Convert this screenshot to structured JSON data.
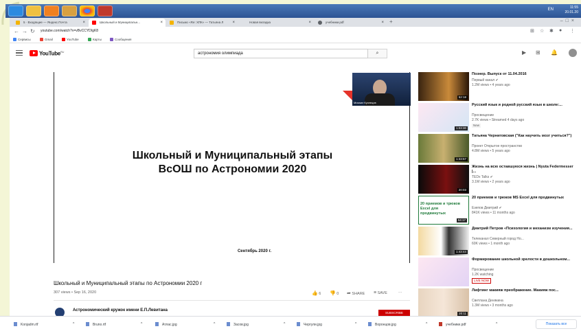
{
  "colors": {
    "youtube_red": "#ff0000",
    "subscribe_red": "#cc0000",
    "taskbar_blue": "#3a68a8",
    "link_blue": "#1a73e8"
  },
  "os_taskbar": {
    "apps": [
      "ie-icon",
      "explorer-icon",
      "media-player-icon",
      "folder-icon",
      "chrome-icon",
      "pdf-icon"
    ],
    "tray_lang": "EN",
    "clock_time": "11:55",
    "clock_date": "20.01.20"
  },
  "browser": {
    "tabs": [
      {
        "label": "5 · Входящие — Яндекс.Почта",
        "color": "#f4b400"
      },
      {
        "label": "Школьный и Муниципальн...",
        "color": "#ff0000",
        "active": true
      },
      {
        "label": "Письмо «Re: ХПК» — Татьяна Л",
        "color": "#f4b400"
      },
      {
        "label": "Новая вкладка",
        "color": "#ffffff"
      },
      {
        "label": "учебники.pdf",
        "color": "#5f6368"
      }
    ],
    "url": "youtube.com/watch?v=vBvCCYDIgK8",
    "bookmarks": [
      {
        "label": "Сервисы",
        "color": "#4285f4"
      },
      {
        "label": "Gmail",
        "color": "#ea4335"
      },
      {
        "label": "YouTube",
        "color": "#ff0000"
      },
      {
        "label": "Карты",
        "color": "#34a853"
      },
      {
        "label": "Сообщения",
        "color": "#7e57c2"
      }
    ]
  },
  "youtube": {
    "logo_text": "YouTube",
    "logo_region": "RU",
    "search_value": "астрономия олимпиада",
    "slide": {
      "title_line1": "Школьный и Муниципальный этапы",
      "title_line2": "ВсОШ по Астрономии 2020",
      "date": "Сентябрь 2020 г.",
      "webcam_label": "Михаил Кузнецов"
    },
    "video_title": "Школьный и Муниципальный этапы по Астрономии 2020 г",
    "video_meta": "307 views • Sep 16, 2020",
    "likes": "6",
    "dislikes": "0",
    "share": "SHARE",
    "save": "SAVE",
    "more": "···",
    "channel_name": "Астрономический кружок имени Е.П.Левитана",
    "subscribe": "SUBSCRIBE"
  },
  "recommendations": [
    {
      "title": "Познер. Выпуск от 11.04.2016",
      "channel": "Первый канал ✔",
      "views": "1.2M views • 4 years ago",
      "duration": "52:18"
    },
    {
      "title": "Русский язык и родной русский язык в школе:...",
      "channel": "Просвещение",
      "views": "2.7K views • Streamed 4 days ago",
      "duration": "1:03:30",
      "badge": "New"
    },
    {
      "title": "Татьяна Черниговская (\"Как научить мозг учиться?\")",
      "channel": "Проект Открытое пространство",
      "views": "4.8M views • 5 years ago",
      "duration": "1:33:57"
    },
    {
      "title": "Жизнь на всю оставшуюся жизнь | Nyuta Federmesser |...",
      "channel": "TEDx Talks ✔",
      "views": "3.1M views • 2 years ago",
      "duration": "20:03"
    },
    {
      "title": "20 приемов и трюков MS Excel для продвинутых",
      "channel": "Езепов Дмитрий ✔",
      "views": "841K views • 11 months ago",
      "duration": "54:17",
      "thumb_text": "20 приемов и трюков Excel для продвинутых"
    },
    {
      "title": "Дмитрий Петров «Психология и механизм изучения...",
      "channel": "Телеканал Северный город Но...",
      "views": "60K views • 1 month ago",
      "duration": "1:43:44"
    },
    {
      "title": "Формирование школьной зрелости в дошкольном...",
      "channel": "Просвещение",
      "views": "1.2K watching",
      "badge": "LIVE NOW",
      "live": true
    },
    {
      "title": "Лифтинг макияж преображение. Макияж пос...",
      "channel": "Светлана Денякина",
      "views": "1.3M views • 3 months ago",
      "duration": "20:11"
    }
  ],
  "downloads": {
    "items": [
      "Konjadm.rtf",
      "Bruno.rtf",
      "Атлас.jpg",
      "Засов.jpg",
      "Чергули.jpg",
      "Воронцов.jpg",
      "учебники.pdf"
    ],
    "show_all": "Показать все"
  }
}
